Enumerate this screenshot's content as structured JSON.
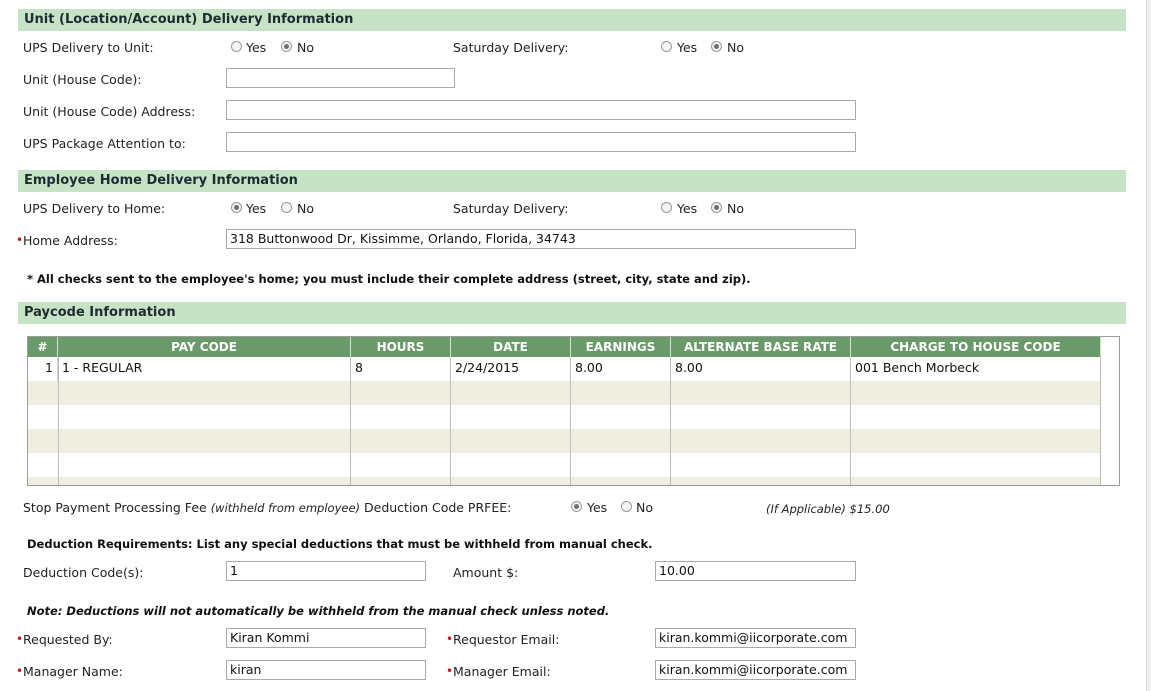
{
  "unit_section": {
    "title": "Unit (Location/Account) Delivery Information",
    "ups_delivery_label": "UPS Delivery to Unit:",
    "ups_delivery_yes": "Yes",
    "ups_delivery_no": "No",
    "ups_delivery_value": "No",
    "saturday_label": "Saturday Delivery:",
    "saturday_yes": "Yes",
    "saturday_no": "No",
    "saturday_value": "No",
    "house_code_label": "Unit (House Code):",
    "house_code_value": "",
    "address_label": "Unit (House Code) Address:",
    "address_value": "",
    "attention_label": "UPS Package Attention to:",
    "attention_value": ""
  },
  "home_section": {
    "title": "Employee Home Delivery Information",
    "ups_delivery_label": "UPS Delivery to Home:",
    "ups_delivery_yes": "Yes",
    "ups_delivery_no": "No",
    "ups_delivery_value": "Yes",
    "saturday_label": "Saturday Delivery:",
    "saturday_yes": "Yes",
    "saturday_no": "No",
    "saturday_value": "No",
    "required_marker": "•",
    "home_address_label": "Home Address:",
    "home_address_value": "318 Buttonwood Dr, Kissimme, Orlando, Florida, 34743",
    "note": "* All checks sent to the employee's home; you must include their complete address (street, city, state and zip)."
  },
  "paycode_section": {
    "title": "Paycode Information",
    "columns": [
      "#",
      "PAY CODE",
      "HOURS",
      "DATE",
      "EARNINGS",
      "ALTERNATE BASE RATE",
      "CHARGE TO HOUSE CODE"
    ],
    "rows": [
      {
        "num": "1",
        "pay_code": "1 - REGULAR",
        "hours": "8",
        "date": "2/24/2015",
        "earnings": "8.00",
        "alt_rate": "8.00",
        "house_code": "001 Bench Morbeck"
      }
    ]
  },
  "stop_payment": {
    "label_start": "Stop Payment Processing Fee",
    "label_italic": "(withheld from employee)",
    "label_end": "Deduction Code PRFEE:",
    "yes": "Yes",
    "no": "No",
    "value": "Yes",
    "applicable": "(If Applicable) $15.00"
  },
  "deductions": {
    "requirements_note": "Deduction Requirements: List any special deductions that must be withheld from manual check.",
    "code_label": "Deduction Code(s):",
    "code_value": "1",
    "amount_label": "Amount $:",
    "amount_value": "10.00",
    "note": "Note: Deductions will not automatically be withheld from the manual check unless noted."
  },
  "requester": {
    "requested_by_label": "Requested By:",
    "requested_by_value": "Kiran Kommi",
    "requestor_email_label": "Requestor Email:",
    "requestor_email_value": "kiran.kommi@iicorporate.com",
    "manager_name_label": "Manager Name:",
    "manager_name_value": "kiran",
    "manager_email_label": "Manager Email:",
    "manager_email_value": "kiran.kommi@iicorporate.com"
  }
}
